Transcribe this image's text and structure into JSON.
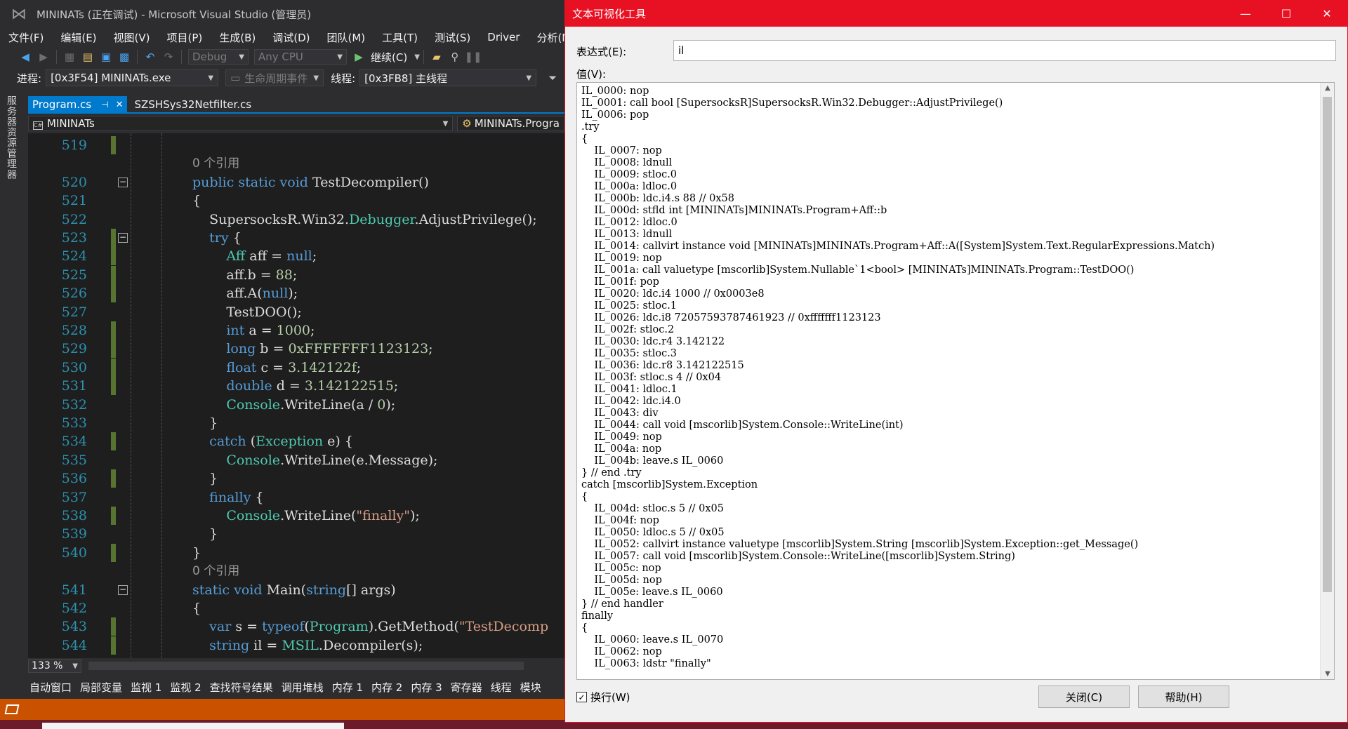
{
  "vs": {
    "window_title": "MININATs (正在调试) - Microsoft Visual Studio (管理员)",
    "menu": [
      "文件(F)",
      "编辑(E)",
      "视图(V)",
      "项目(P)",
      "生成(B)",
      "调试(D)",
      "团队(M)",
      "工具(T)",
      "测试(S)",
      "Driver",
      "分析(N)"
    ],
    "toolbar": {
      "config": "Debug",
      "platform": "Any CPU",
      "continue_label": "继续(C)"
    },
    "debug_bar": {
      "process_label": "进程:",
      "process_value": "[0x3F54] MININATs.exe",
      "lifecycle_label": "生命周期事件",
      "thread_label": "线程:",
      "thread_value": "[0x3FB8] 主线程"
    },
    "side_panel_label": "服务器资源管理器",
    "tabs": [
      {
        "label": "Program.cs",
        "active": true
      },
      {
        "label": "SZSHSys32Netfilter.cs",
        "active": false
      }
    ],
    "nav": {
      "project": "MININATs",
      "member": "MININATs.Progra"
    },
    "code_lines": [
      {
        "n": "519",
        "html": ""
      },
      {
        "n": "",
        "ref": "0 个引用"
      },
      {
        "n": "520",
        "html": "<span class='kw'>public</span> <span class='kw'>static</span> <span class='kw'>void</span> TestDecompiler()"
      },
      {
        "n": "521",
        "html": "{"
      },
      {
        "n": "522",
        "html": "    SupersocksR.Win32.<span class='ty'>Debugger</span>.AdjustPrivilege();"
      },
      {
        "n": "523",
        "html": "    <span class='kw'>try</span> {"
      },
      {
        "n": "524",
        "html": "        <span class='ty'>Aff</span> aff = <span class='kw'>null</span>;"
      },
      {
        "n": "525",
        "html": "        aff.b = <span class='nu'>88</span>;"
      },
      {
        "n": "526",
        "html": "        aff.A(<span class='kw'>null</span>);"
      },
      {
        "n": "527",
        "html": "        TestDOO();"
      },
      {
        "n": "528",
        "html": "        <span class='kw'>int</span> a = <span class='nu'>1000</span>;"
      },
      {
        "n": "529",
        "html": "        <span class='kw'>long</span> b = <span class='nu'>0xFFFFFFF1123123</span>;"
      },
      {
        "n": "530",
        "html": "        <span class='kw'>float</span> c = <span class='nu'>3.142122f</span>;"
      },
      {
        "n": "531",
        "html": "        <span class='kw'>double</span> d = <span class='nu'>3.142122515</span>;"
      },
      {
        "n": "532",
        "html": "        <span class='ty'>Console</span>.WriteLine(a / <span class='nu'>0</span>);"
      },
      {
        "n": "533",
        "html": "    }"
      },
      {
        "n": "534",
        "html": "    <span class='kw'>catch</span> (<span class='ty'>Exception</span> e) {"
      },
      {
        "n": "535",
        "html": "        <span class='ty'>Console</span>.WriteLine(e.Message);"
      },
      {
        "n": "536",
        "html": "    }"
      },
      {
        "n": "537",
        "html": "    <span class='kw'>finally</span> {"
      },
      {
        "n": "538",
        "html": "        <span class='ty'>Console</span>.WriteLine(<span class='st'>\"finally\"</span>);"
      },
      {
        "n": "539",
        "html": "    }"
      },
      {
        "n": "540",
        "html": "}"
      },
      {
        "n": "",
        "ref": "0 个引用"
      },
      {
        "n": "541",
        "html": "<span class='kw'>static</span> <span class='kw'>void</span> Main(<span class='kw'>string</span>[] args)"
      },
      {
        "n": "542",
        "html": "{"
      },
      {
        "n": "543",
        "html": "    <span class='kw'>var</span> s = <span class='kw'>typeof</span>(<span class='ty'>Program</span>).GetMethod(<span class='st'>\"TestDecomp</span>"
      },
      {
        "n": "544",
        "html": "    <span class='kw'>string</span> il = <span class='ty'>MSIL</span>.Decompiler(s);"
      }
    ],
    "zoom": "133 %",
    "bottom_tabs": [
      "自动窗口",
      "局部变量",
      "监视 1",
      "监视 2",
      "查找符号结果",
      "调用堆栈",
      "内存 1",
      "内存 2",
      "内存 3",
      "寄存器",
      "线程",
      "模块"
    ]
  },
  "dialog": {
    "title": "文本可视化工具",
    "expression_label": "表达式(E):",
    "expression_value": "il",
    "value_label": "值(V):",
    "value_text": "IL_0000: nop\nIL_0001: call bool [SupersocksR]SupersocksR.Win32.Debugger::AdjustPrivilege()\nIL_0006: pop\n.try\n{\n    IL_0007: nop\n    IL_0008: ldnull\n    IL_0009: stloc.0\n    IL_000a: ldloc.0\n    IL_000b: ldc.i4.s 88 // 0x58\n    IL_000d: stfld int [MININATs]MININATs.Program+Aff::b\n    IL_0012: ldloc.0\n    IL_0013: ldnull\n    IL_0014: callvirt instance void [MININATs]MININATs.Program+Aff::A([System]System.Text.RegularExpressions.Match)\n    IL_0019: nop\n    IL_001a: call valuetype [mscorlib]System.Nullable`1<bool> [MININATs]MININATs.Program::TestDOO()\n    IL_001f: pop\n    IL_0020: ldc.i4 1000 // 0x0003e8\n    IL_0025: stloc.1\n    IL_0026: ldc.i8 72057593787461923 // 0xfffffff1123123\n    IL_002f: stloc.2\n    IL_0030: ldc.r4 3.142122\n    IL_0035: stloc.3\n    IL_0036: ldc.r8 3.142122515\n    IL_003f: stloc.s 4 // 0x04\n    IL_0041: ldloc.1\n    IL_0042: ldc.i4.0\n    IL_0043: div\n    IL_0044: call void [mscorlib]System.Console::WriteLine(int)\n    IL_0049: nop\n    IL_004a: nop\n    IL_004b: leave.s IL_0060\n} // end .try\ncatch [mscorlib]System.Exception\n{\n    IL_004d: stloc.s 5 // 0x05\n    IL_004f: nop\n    IL_0050: ldloc.s 5 // 0x05\n    IL_0052: callvirt instance valuetype [mscorlib]System.String [mscorlib]System.Exception::get_Message()\n    IL_0057: call void [mscorlib]System.Console::WriteLine([mscorlib]System.String)\n    IL_005c: nop\n    IL_005d: nop\n    IL_005e: leave.s IL_0060\n} // end handler\nfinally\n{\n    IL_0060: leave.s IL_0070\n    IL_0062: nop\n    IL_0063: ldstr \"finally\"",
    "wrap_label": "换行(W)",
    "wrap_checked": true,
    "close_button": "关闭(C)",
    "help_button": "帮助(H)"
  }
}
